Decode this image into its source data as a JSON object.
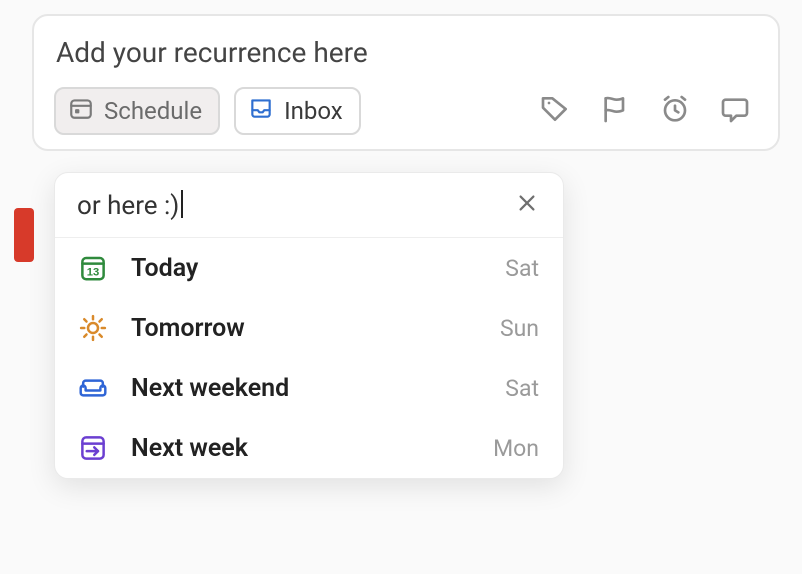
{
  "task": {
    "placeholder": "Add your recurrence here"
  },
  "toolbar": {
    "schedule_label": "Schedule",
    "inbox_label": "Inbox"
  },
  "dropdown": {
    "search_value": "or here :)",
    "items": [
      {
        "icon": "calendar-13-icon",
        "label": "Today",
        "hint": "Sat",
        "color": "#2f8a3c"
      },
      {
        "icon": "sun-icon",
        "label": "Tomorrow",
        "hint": "Sun",
        "color": "#d98a2b"
      },
      {
        "icon": "couch-icon",
        "label": "Next weekend",
        "hint": "Sat",
        "color": "#2f65d6"
      },
      {
        "icon": "arrow-box-icon",
        "label": "Next week",
        "hint": "Mon",
        "color": "#6b3fd1"
      }
    ]
  }
}
